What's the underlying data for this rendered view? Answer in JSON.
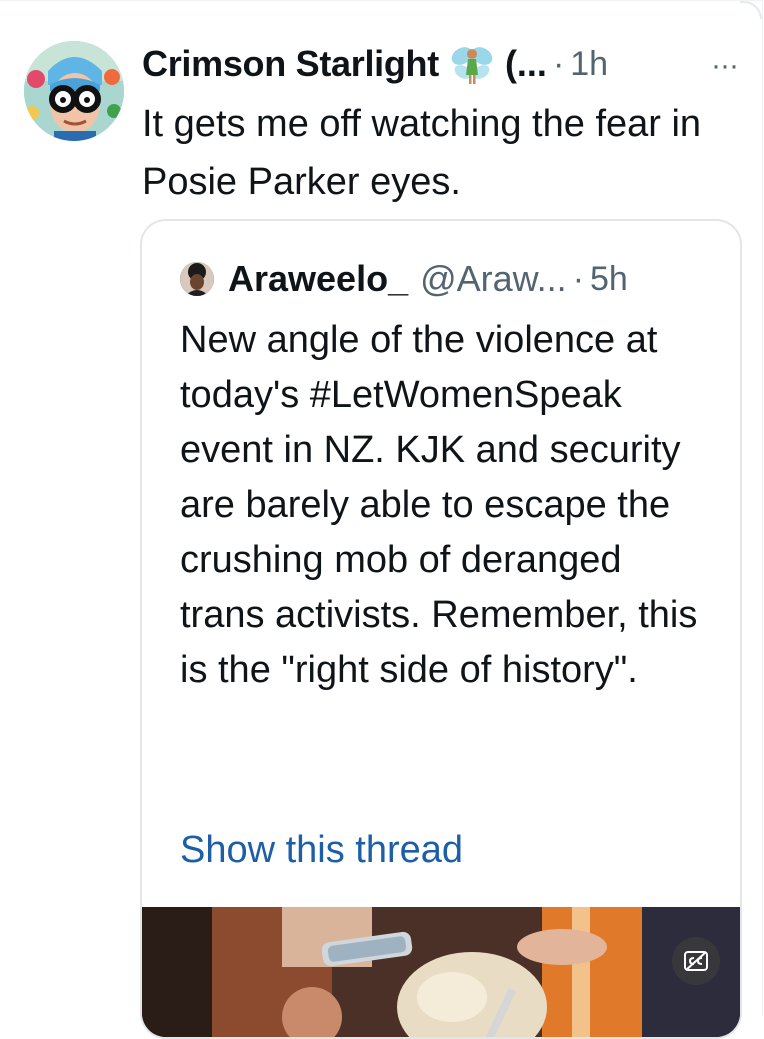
{
  "tweet": {
    "author_name": "Crimson Starlight",
    "author_name_truncated": "(...",
    "separator": "·",
    "time": "1h",
    "more_label": "···",
    "text": "It gets me off watching the fear in Posie Parker eyes.",
    "emoji_icon": "fairy-icon"
  },
  "quoted_tweet": {
    "author_name": "Araweelo_",
    "handle": "@Araw...",
    "separator": "·",
    "time": "5h",
    "text": "New angle of the violence at today's #LetWomenSpeak event in NZ. KJK and security are barely able to escape the crushing mob of deranged trans activists. Remember, this is the \"right side of history\".",
    "show_thread_label": "Show this thread"
  },
  "colors": {
    "text": "#0f1419",
    "secondary": "#536471",
    "link": "#1d5fa6",
    "border": "#e2e6e8"
  }
}
